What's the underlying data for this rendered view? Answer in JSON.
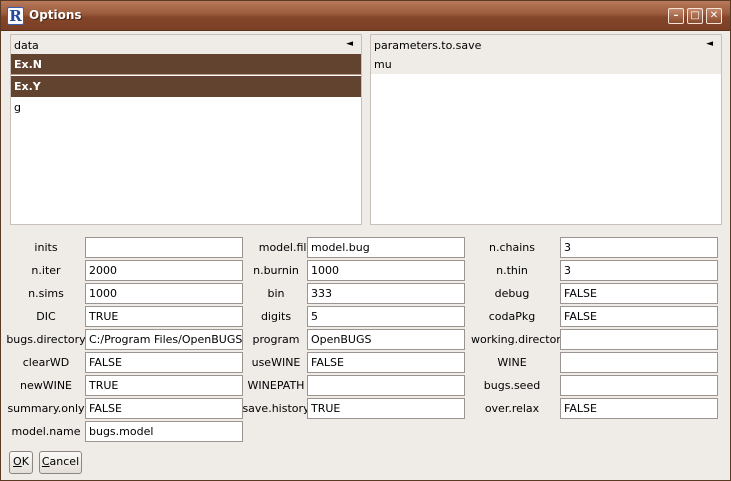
{
  "window": {
    "title": "Options",
    "app_icon": "R"
  },
  "title_buttons": {
    "minimize": "–",
    "maximize": "□",
    "close": "✕"
  },
  "data_panel": {
    "header": "data",
    "sort_icon": "◄",
    "items": [
      "Ex.N",
      "Ex.Y",
      "g"
    ]
  },
  "params_panel": {
    "header": "parameters.to.save",
    "sort_icon": "◄",
    "items": [
      "mu"
    ]
  },
  "fields": {
    "inits": {
      "label": "inits",
      "value": ""
    },
    "model_file": {
      "label": "model.file",
      "value": "model.bug"
    },
    "n_chains": {
      "label": "n.chains",
      "value": "3"
    },
    "n_iter": {
      "label": "n.iter",
      "value": "2000"
    },
    "n_burnin": {
      "label": "n.burnin",
      "value": "1000"
    },
    "n_thin": {
      "label": "n.thin",
      "value": "3"
    },
    "n_sims": {
      "label": "n.sims",
      "value": "1000"
    },
    "bin": {
      "label": "bin",
      "value": "333"
    },
    "debug": {
      "label": "debug",
      "value": "FALSE"
    },
    "dic": {
      "label": "DIC",
      "value": "TRUE"
    },
    "digits": {
      "label": "digits",
      "value": "5"
    },
    "codapkg": {
      "label": "codaPkg",
      "value": "FALSE"
    },
    "bugs_directory": {
      "label": "bugs.directory",
      "value": "C:/Program Files/OpenBUGS"
    },
    "program": {
      "label": "program",
      "value": "OpenBUGS"
    },
    "working_directory": {
      "label": "working.directory",
      "value": ""
    },
    "clearwd": {
      "label": "clearWD",
      "value": "FALSE"
    },
    "usewine": {
      "label": "useWINE",
      "value": "FALSE"
    },
    "wine": {
      "label": "WINE",
      "value": ""
    },
    "newwine": {
      "label": "newWINE",
      "value": "TRUE"
    },
    "winepath": {
      "label": "WINEPATH",
      "value": ""
    },
    "bugs_seed": {
      "label": "bugs.seed",
      "value": ""
    },
    "summary_only": {
      "label": "summary.only",
      "value": "FALSE"
    },
    "save_history": {
      "label": "save.history",
      "value": "TRUE"
    },
    "over_relax": {
      "label": "over.relax",
      "value": "FALSE"
    },
    "model_name": {
      "label": "model.name",
      "value": "bugs.model"
    }
  },
  "buttons": {
    "ok": {
      "mnemonic": "O",
      "rest": "K"
    },
    "cancel": {
      "mnemonic": "C",
      "rest": "ancel"
    }
  }
}
